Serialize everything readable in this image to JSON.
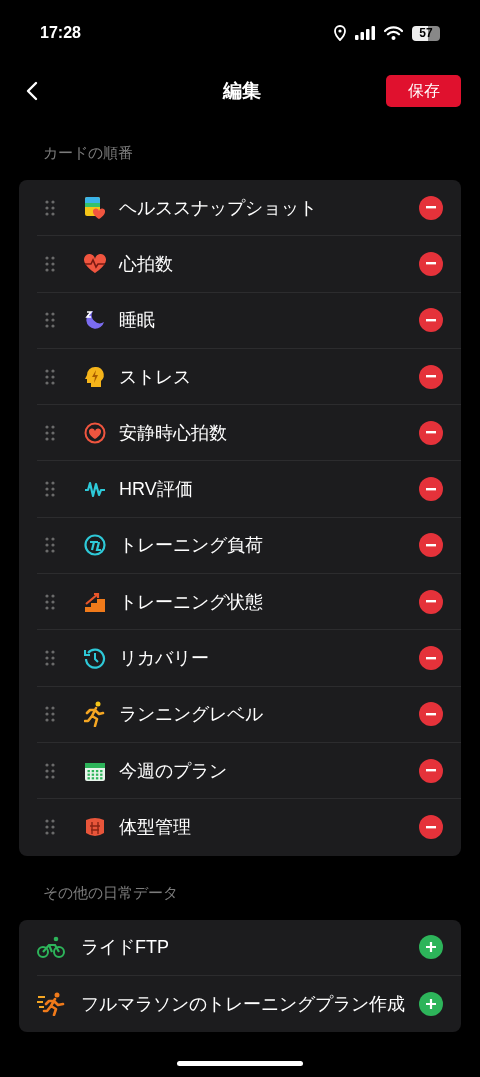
{
  "status_bar": {
    "time": "17:28",
    "battery": "57"
  },
  "header": {
    "title": "編集",
    "save": "保存"
  },
  "sections": [
    {
      "label": "カードの順番",
      "items": [
        {
          "label": "ヘルススナップショット",
          "kind": "snapshot"
        },
        {
          "label": "心拍数",
          "kind": "heart"
        },
        {
          "label": "睡眠",
          "kind": "sleep"
        },
        {
          "label": "ストレス",
          "kind": "stress"
        },
        {
          "label": "安静時心拍数",
          "kind": "resting"
        },
        {
          "label": "HRV評価",
          "kind": "hrv"
        },
        {
          "label": "トレーニング負荷",
          "kind": "load"
        },
        {
          "label": "トレーニング状態",
          "kind": "status"
        },
        {
          "label": "リカバリー",
          "kind": "recovery"
        },
        {
          "label": "ランニングレベル",
          "kind": "running"
        },
        {
          "label": "今週のプラン",
          "kind": "plan"
        },
        {
          "label": "体型管理",
          "kind": "body"
        }
      ]
    },
    {
      "label": "その他の日常データ",
      "items": [
        {
          "label": "ライドFTP",
          "kind": "bike"
        },
        {
          "label": "フルマラソンのトレーニングプラン作成",
          "kind": "marathon"
        }
      ]
    }
  ]
}
